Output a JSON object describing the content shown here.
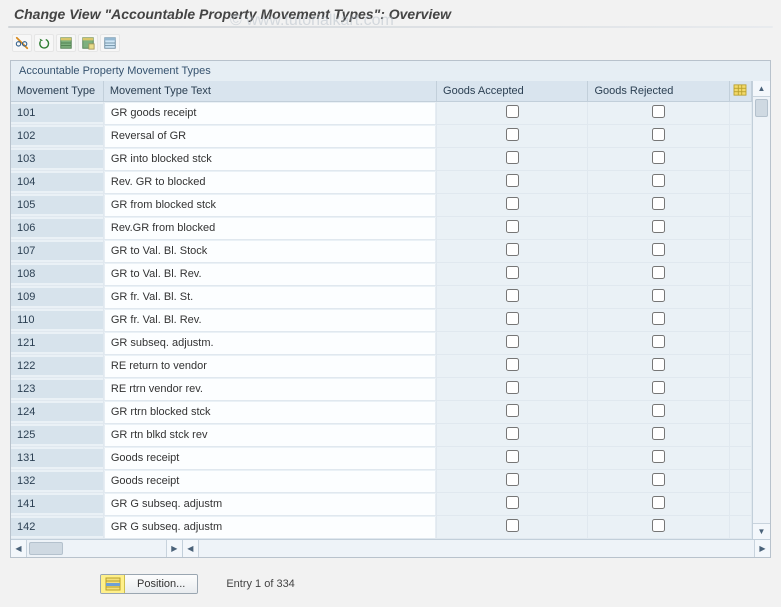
{
  "title": "Change View \"Accountable Property Movement Types\": Overview",
  "watermark": "© www.tutorialkart.com",
  "toolbar": {
    "tooltips": {
      "other_view": "Other View",
      "undo": "Undo",
      "new_entries": "New Entries",
      "copy_as": "Copy As",
      "delete": "Delete"
    }
  },
  "panel": {
    "title": "Accountable Property Movement Types",
    "columns": {
      "mt": "Movement Type",
      "txt": "Movement Type Text",
      "ga": "Goods Accepted",
      "gr": "Goods Rejected"
    },
    "rows": [
      {
        "mt": "101",
        "txt": "GR goods receipt",
        "ga": false,
        "gr": false
      },
      {
        "mt": "102",
        "txt": "Reversal of GR",
        "ga": false,
        "gr": false
      },
      {
        "mt": "103",
        "txt": "GR into blocked stck",
        "ga": false,
        "gr": false
      },
      {
        "mt": "104",
        "txt": "Rev. GR to blocked",
        "ga": false,
        "gr": false
      },
      {
        "mt": "105",
        "txt": "GR from blocked stck",
        "ga": false,
        "gr": false
      },
      {
        "mt": "106",
        "txt": "Rev.GR from blocked",
        "ga": false,
        "gr": false
      },
      {
        "mt": "107",
        "txt": "GR to Val. Bl. Stock",
        "ga": false,
        "gr": false
      },
      {
        "mt": "108",
        "txt": "GR to Val. Bl. Rev.",
        "ga": false,
        "gr": false
      },
      {
        "mt": "109",
        "txt": "GR fr. Val. Bl. St.",
        "ga": false,
        "gr": false
      },
      {
        "mt": "110",
        "txt": "GR fr. Val. Bl. Rev.",
        "ga": false,
        "gr": false
      },
      {
        "mt": "121",
        "txt": "GR subseq. adjustm.",
        "ga": false,
        "gr": false
      },
      {
        "mt": "122",
        "txt": "RE return to vendor",
        "ga": false,
        "gr": false
      },
      {
        "mt": "123",
        "txt": "RE rtrn vendor rev.",
        "ga": false,
        "gr": false
      },
      {
        "mt": "124",
        "txt": "GR rtrn blocked stck",
        "ga": false,
        "gr": false
      },
      {
        "mt": "125",
        "txt": "GR rtn blkd stck rev",
        "ga": false,
        "gr": false
      },
      {
        "mt": "131",
        "txt": "Goods receipt",
        "ga": false,
        "gr": false
      },
      {
        "mt": "132",
        "txt": "Goods receipt",
        "ga": false,
        "gr": false
      },
      {
        "mt": "141",
        "txt": "GR G subseq. adjustm",
        "ga": false,
        "gr": false
      },
      {
        "mt": "142",
        "txt": "GR G subseq. adjustm",
        "ga": false,
        "gr": false
      }
    ]
  },
  "footer": {
    "position_label": "Position...",
    "entry_text": "Entry 1 of 334"
  },
  "icons": {
    "config_col": "table-config-icon"
  }
}
